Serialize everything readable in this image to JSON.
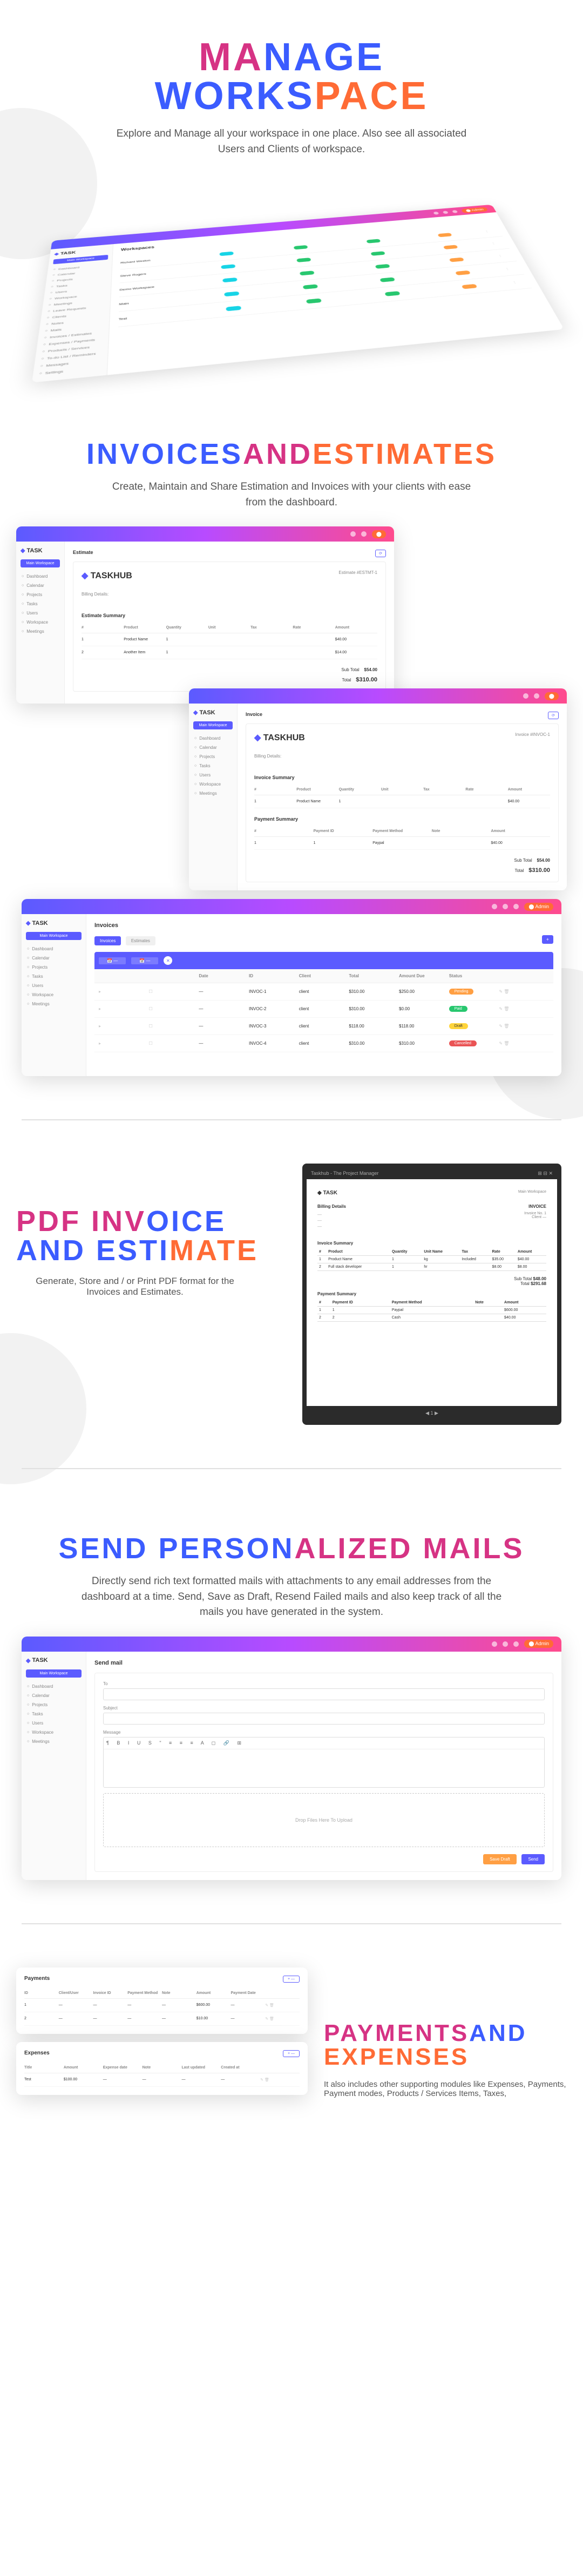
{
  "s1": {
    "title1a": "MA",
    "title1b": "NAGE",
    "title2a": "WORKS",
    "title2b": "PACE",
    "desc": "Explore and Manage all your workspace in one place. Also see all associated Users and Clients of workspace.",
    "logo": "TASK",
    "menuBtn": "Main Workspace",
    "sideItems": [
      "Dashboard",
      "Calendar",
      "Projects",
      "Tasks",
      "Users",
      "Workspace",
      "Meetings",
      "Leave Requests",
      "Clients",
      "Notes",
      "Mails",
      "Invoices / Estimates",
      "Expenses / Payments",
      "Products / Services",
      "To-do List / Reminders",
      "Messages",
      "Settings"
    ],
    "panelTitle": "Workspaces",
    "ws": [
      {
        "name": "Richard Weston",
        "cols": [
          "",
          "",
          "",
          ""
        ]
      },
      {
        "name": "Steve Rogers",
        "cols": [
          "",
          "",
          "",
          ""
        ]
      },
      {
        "name": "Demo Workspace",
        "cols": [
          "",
          "",
          "",
          ""
        ]
      },
      {
        "name": "Main",
        "cols": [
          "",
          "",
          "",
          ""
        ]
      },
      {
        "name": "Test",
        "cols": [
          "",
          "",
          "",
          ""
        ]
      }
    ]
  },
  "s2": {
    "title1": "INVOICES ",
    "title2": "AND",
    "title3": " ESTIMATES",
    "desc": "Create, Maintain and Share Estimation and Invoices with your clients with ease from the dashboard.",
    "estimate": {
      "label": "Estimate",
      "id": "Estimate #ESTMT-1",
      "logo": "TASKHUB",
      "billTo": "Billing Details:",
      "summary": "Estimate Summary",
      "cols": [
        "#",
        "Product",
        "Quantity",
        "Unit",
        "Tax",
        "Rate",
        "Amount"
      ],
      "items": [
        {
          "n": "1",
          "p": "Product Name",
          "q": "1",
          "u": "",
          "t": "",
          "r": "",
          "a": "$40.00"
        },
        {
          "n": "2",
          "p": "Another Item",
          "q": "1",
          "u": "",
          "t": "",
          "r": "",
          "a": "$14.00"
        }
      ],
      "subTotal": "Sub Total",
      "subTotalV": "$54.00",
      "total": "Total",
      "totalV": "$310.00"
    },
    "invoice": {
      "label": "Invoice",
      "id": "Invoice #INVOC-1",
      "logo": "TASKHUB",
      "billTo": "Billing Details:",
      "summary": "Invoice Summary",
      "cols": [
        "#",
        "Product",
        "Quantity",
        "Unit",
        "Tax",
        "Rate",
        "Amount"
      ],
      "items": [
        {
          "n": "1",
          "p": "Product Name",
          "q": "1",
          "u": "",
          "t": "",
          "r": "",
          "a": "$40.00"
        }
      ],
      "paySummary": "Payment Summary",
      "payCols": [
        "#",
        "Payment ID",
        "Payment Method",
        "Note",
        "Amount"
      ],
      "payItems": [
        {
          "n": "1",
          "id": "1",
          "m": "Paypal",
          "note": "",
          "a": "$40.00"
        }
      ],
      "subTotal": "Sub Total",
      "subTotalV": "$54.00",
      "total": "Total",
      "totalV": "$310.00"
    },
    "listView": {
      "label": "Invoices",
      "tabs": [
        "Invoices",
        "Estimates"
      ],
      "addBtn": "+",
      "cols": [
        "",
        "",
        "Date",
        "ID",
        "Client",
        "Total",
        "Amount Due",
        "Status",
        ""
      ],
      "rows": [
        {
          "d": "—",
          "id": "INVOC-1",
          "c": "client",
          "t": "$310.00",
          "due": "$250.00",
          "s": "Pending",
          "sc": "pill-orange"
        },
        {
          "d": "—",
          "id": "INVOC-2",
          "c": "client",
          "t": "$310.00",
          "due": "$0.00",
          "s": "Paid",
          "sc": "pill-green"
        },
        {
          "d": "—",
          "id": "INVOC-3",
          "c": "client",
          "t": "$118.00",
          "due": "$118.00",
          "s": "Draft",
          "sc": "pill-yellow"
        },
        {
          "d": "—",
          "id": "INVOC-4",
          "c": "client",
          "t": "$310.00",
          "due": "$310.00",
          "s": "Cancelled",
          "sc": "pill-red"
        }
      ]
    }
  },
  "s3": {
    "title1": "PDF INV",
    "title2": "OICE",
    "title3": "AND ESTI",
    "title4": "MATE",
    "desc": "Generate, Store and / or Print PDF format for the Invoices and Estimates.",
    "pdf": {
      "header": "Taskhub - The Project Manager",
      "ws": "Main Workspace",
      "bill": "Billing Details",
      "inv": "INVOICE",
      "invno": "Invoice No.",
      "client": "Client",
      "sum": "Invoice Summary",
      "cols": [
        "#",
        "Product",
        "Quantity",
        "Unit Name",
        "Tax",
        "Rate",
        "Amount"
      ],
      "r1": [
        "1",
        "Product Name",
        "1",
        "kg",
        "Included",
        "$35.00",
        "$40.00"
      ],
      "r2": [
        "2",
        "Full stack developer",
        "1",
        "hr",
        "",
        "$8.00",
        "$8.00"
      ],
      "sub": "Sub Total",
      "subV": "$48.00",
      "tot": "Total",
      "totV": "$291.68",
      "pay": "Payment Summary",
      "pcols": [
        "#",
        "Payment ID",
        "Payment Method",
        "Note",
        "Amount"
      ],
      "p1": [
        "1",
        "1",
        "Paypal",
        "",
        "$600.00"
      ],
      "p2": [
        "2",
        "2",
        "Cash",
        "",
        "$40.00"
      ]
    }
  },
  "s4": {
    "title1": "SEND PERSON",
    "title2": "ALIZED MAILS",
    "desc": "Directly send rich text formatted mails with attachments to any email addresses from the dashboard at a time. Send, Save as Draft, Resend Failed mails and also keep track of all the mails you have generated in the system.",
    "form": {
      "title": "Send mail",
      "to": "To",
      "subject": "Subject",
      "msg": "Message",
      "drop": "Drop Files Here To Upload",
      "btn1": "Save Draft",
      "btn2": "Send"
    }
  },
  "s5": {
    "pay": {
      "title": "Payments",
      "cols": [
        "ID",
        "Client/User",
        "Invoice ID",
        "Payment Method",
        "Note",
        "Amount",
        "Payment Date",
        ""
      ],
      "rows": [
        {
          "id": "1",
          "c": "",
          "inv": "",
          "m": "",
          "n": "",
          "a": "$600.00",
          "d": ""
        },
        {
          "id": "2",
          "c": "",
          "inv": "",
          "m": "",
          "n": "",
          "a": "$10.00",
          "d": ""
        }
      ]
    },
    "exp": {
      "title": "Expenses",
      "cols": [
        "Title",
        "Amount",
        "Expense date",
        "Note",
        "Last updated",
        "Created at",
        ""
      ],
      "rows": [
        {
          "t": "Test",
          "a": "$100.00",
          "d": "",
          "n": "",
          "u": "",
          "c": ""
        }
      ]
    },
    "title1": "PAYMENTS ",
    "title2": "AND",
    "title3": "EXPENSES",
    "desc": "It also includes other supporting modules like Expenses, Payments, Payment modes, Products / Services Items, Taxes,"
  },
  "sidebarShort": [
    "Dashboard",
    "Calendar",
    "Projects",
    "Tasks",
    "Users",
    "Workspace",
    "Meetings"
  ]
}
